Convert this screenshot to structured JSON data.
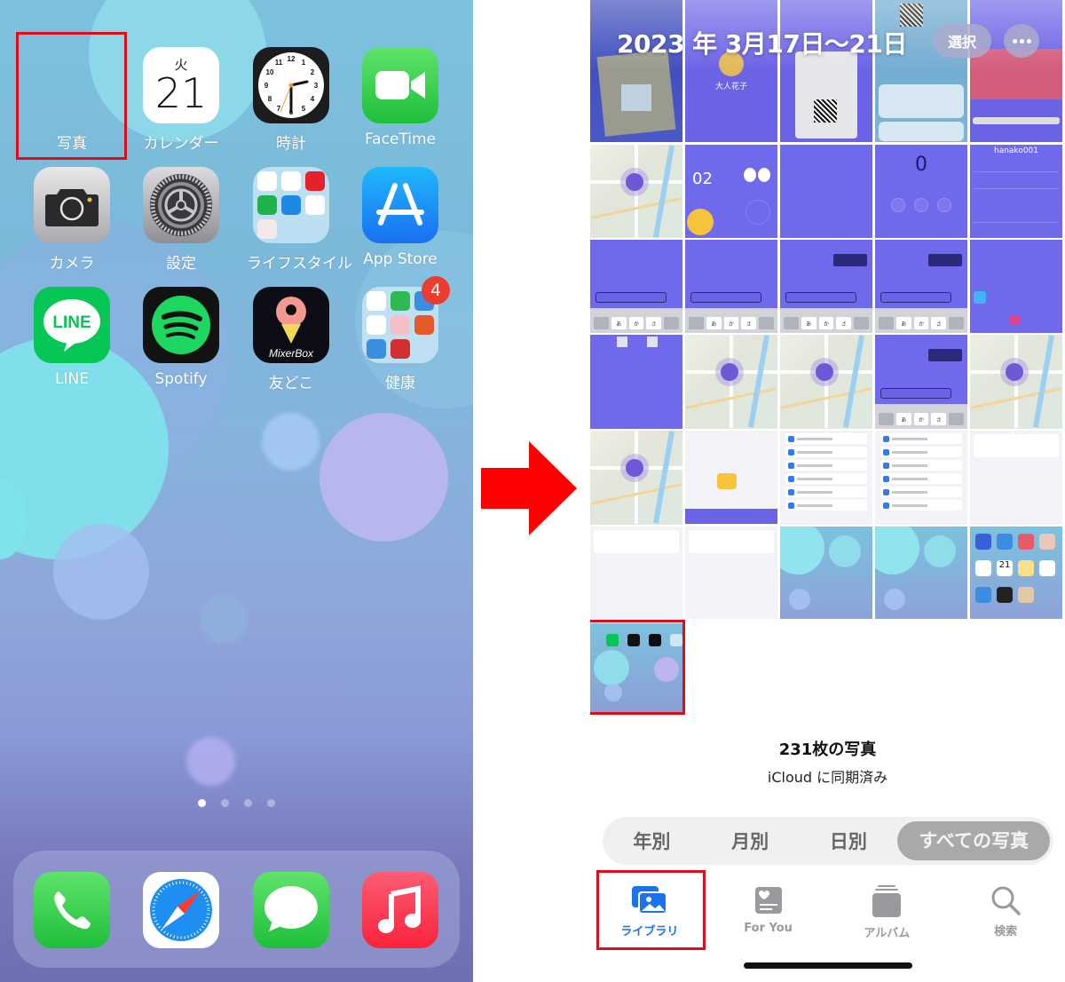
{
  "home_screen": {
    "apps_row1": [
      {
        "label": "写真",
        "icon": "photos-icon",
        "highlighted": true
      },
      {
        "label": "カレンダー",
        "icon": "calendar-icon",
        "calendar_dow": "火",
        "calendar_day": "21"
      },
      {
        "label": "時計",
        "icon": "clock-icon"
      },
      {
        "label": "FaceTime",
        "icon": "facetime-icon"
      }
    ],
    "apps_row2": [
      {
        "label": "カメラ",
        "icon": "camera-icon"
      },
      {
        "label": "設定",
        "icon": "settings-icon"
      },
      {
        "label": "ライフスタイル",
        "icon": "folder-icon"
      },
      {
        "label": "App Store",
        "icon": "app-store-icon"
      }
    ],
    "apps_row3": [
      {
        "label": "LINE",
        "icon": "line-icon",
        "icon_text": "LINE"
      },
      {
        "label": "Spotify",
        "icon": "spotify-icon"
      },
      {
        "label": "友どこ",
        "icon": "mixerbox-icon",
        "icon_text": "MixerBox"
      },
      {
        "label": "健康",
        "icon": "folder-icon",
        "badge": "4"
      }
    ],
    "page_dots": {
      "count": 4,
      "active_index": 0
    },
    "dock": [
      {
        "name": "Phone",
        "icon": "phone-icon"
      },
      {
        "name": "Safari",
        "icon": "safari-icon"
      },
      {
        "name": "Messages",
        "icon": "messages-icon"
      },
      {
        "name": "Music",
        "icon": "music-icon"
      }
    ]
  },
  "arrow": {
    "direction": "right",
    "color": "#ff0000"
  },
  "photos_app": {
    "header": {
      "date_range": "2023 年 3月17日〜21日",
      "select_label": "選択",
      "more_icon": "ellipsis-icon"
    },
    "grid_thumbnails": [
      "map",
      "qr-scan-photo",
      "profile-screen",
      "qr-code-screen",
      "notification-center",
      "pink-screen",
      "map",
      "counter-screen",
      "purple-screen",
      "stats-screen",
      "profile-settings",
      "chat-keyboard",
      "chat-keyboard",
      "chat-keyboard",
      "chat-keyboard",
      "settings-purple",
      "friend-list",
      "map",
      "map",
      "chat-keyboard",
      "map",
      "map",
      "map-input",
      "ios-settings",
      "ios-settings",
      "notes-screen",
      "notes-screen",
      "notes-screen",
      "wallpaper",
      "wallpaper",
      "home-screen",
      "home-screen-highlighted"
    ],
    "thumbnail_labels": {
      "profile_name": "大人花子",
      "username": "hanako001",
      "counter": "02",
      "counter_zero": "0",
      "calendar_day": "21"
    },
    "footer": {
      "count_label": "231枚の写真",
      "sync_label": "iCloud に同期済み"
    },
    "segments": [
      {
        "label": "年別",
        "active": false
      },
      {
        "label": "月別",
        "active": false
      },
      {
        "label": "日別",
        "active": false
      },
      {
        "label": "すべての写真",
        "active": true
      }
    ],
    "tabs": [
      {
        "label": "ライブラリ",
        "icon": "library-icon",
        "active": true,
        "highlighted": true
      },
      {
        "label": "For You",
        "icon": "for-you-icon",
        "active": false
      },
      {
        "label": "アルバム",
        "icon": "albums-icon",
        "active": false
      },
      {
        "label": "検索",
        "icon": "search-icon",
        "active": false
      }
    ]
  },
  "colors": {
    "highlight_box": "#e10c1a",
    "active_tab": "#1a73e8",
    "inactive_tab": "#9a9a9e"
  }
}
